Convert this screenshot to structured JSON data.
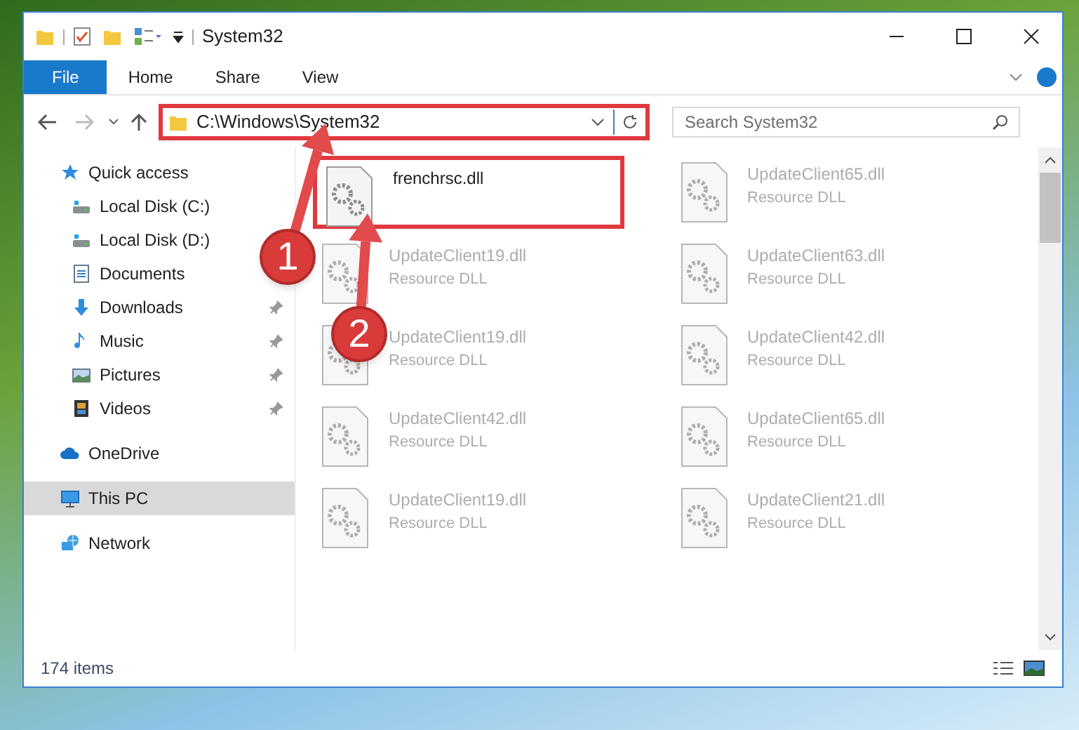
{
  "window": {
    "title": "System32"
  },
  "ribbon_tabs": [
    {
      "label": "File",
      "selected": true
    },
    {
      "label": "Home",
      "selected": false
    },
    {
      "label": "Share",
      "selected": false
    },
    {
      "label": "View",
      "selected": false
    }
  ],
  "address": {
    "path": "C:\\Windows\\System32",
    "highlighted": true
  },
  "search": {
    "placeholder": "Search System32"
  },
  "nav": [
    {
      "label": "Quick access",
      "kind": "star",
      "selected": false,
      "children": [
        {
          "label": "Local Disk (C:)",
          "kind": "drive",
          "pinned": false,
          "selected": false
        },
        {
          "label": "Local Disk (D:)",
          "kind": "drive",
          "pinned": false,
          "selected": false
        },
        {
          "label": "Documents",
          "kind": "doc",
          "pinned": false,
          "selected": false
        },
        {
          "label": "Downloads",
          "kind": "download",
          "pinned": true,
          "selected": false
        },
        {
          "label": "Music",
          "kind": "music",
          "pinned": true,
          "selected": false
        },
        {
          "label": "Pictures",
          "kind": "picture",
          "pinned": true,
          "selected": false
        },
        {
          "label": "Videos",
          "kind": "video",
          "pinned": true,
          "selected": false
        }
      ]
    },
    {
      "label": "OneDrive",
      "kind": "cloud",
      "selected": false
    },
    {
      "label": "This PC",
      "kind": "pc",
      "selected": true
    },
    {
      "label": "Network",
      "kind": "network",
      "selected": false
    }
  ],
  "files": [
    {
      "name": "frenchrsc.dll",
      "highlighted": true,
      "blurred": false
    },
    {
      "name": "UpdateClient65.dll",
      "type": "Resource DLL",
      "highlighted": false,
      "blurred": true
    },
    {
      "name": "UpdateClient19.dll",
      "type": "Resource DLL",
      "highlighted": false,
      "blurred": true
    },
    {
      "name": "UpdateClient63.dll",
      "type": "Resource DLL",
      "highlighted": false,
      "blurred": true
    },
    {
      "name": "UpdateClient19.dll",
      "type": "Resource DLL",
      "highlighted": false,
      "blurred": true
    },
    {
      "name": "UpdateClient42.dll",
      "type": "Resource DLL",
      "highlighted": false,
      "blurred": true
    },
    {
      "name": "UpdateClient42.dll",
      "type": "Resource DLL",
      "highlighted": false,
      "blurred": true
    },
    {
      "name": "UpdateClient65.dll",
      "type": "Resource DLL",
      "highlighted": false,
      "blurred": true
    },
    {
      "name": "UpdateClient19.dll",
      "type": "Resource DLL",
      "highlighted": false,
      "blurred": true
    },
    {
      "name": "UpdateClient21.dll",
      "type": "Resource DLL",
      "highlighted": false,
      "blurred": true
    }
  ],
  "status_bar": {
    "count": "174 items"
  },
  "annotations": [
    {
      "number": "1"
    },
    {
      "number": "2"
    }
  ]
}
